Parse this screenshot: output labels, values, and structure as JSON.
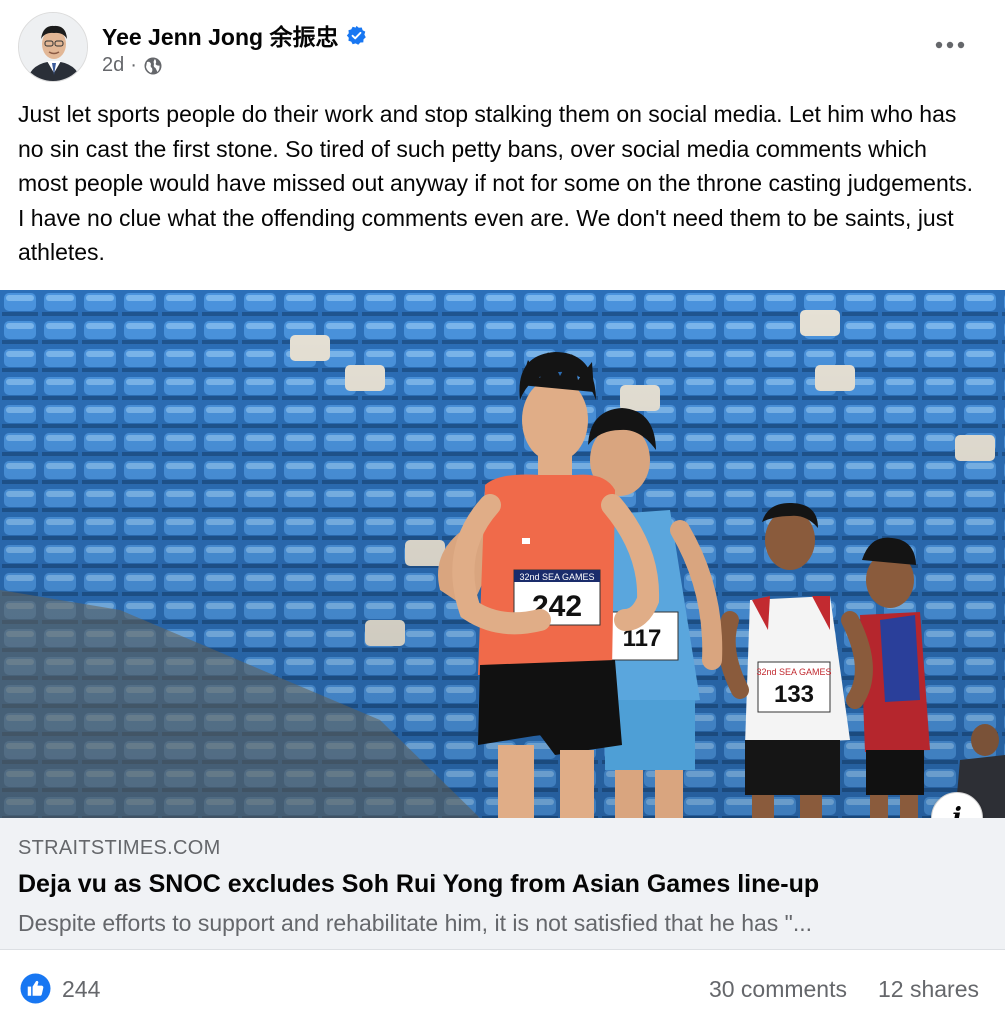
{
  "post": {
    "author": "Yee Jenn Jong 余振忠",
    "time": "2d",
    "separator": "·",
    "text": "Just let sports people do their work and stop stalking them on social media. Let him who has no sin cast the first stone. So tired of such petty bans, over social media comments which most people would have missed out anyway if not for some on the throne casting judgements. I have no clue what the offending comments  even are. We don't need them to be saints, just athletes."
  },
  "photo": {
    "bibs": [
      "242",
      "117",
      "133"
    ],
    "bib_caption": "32nd SEA GAMES"
  },
  "link": {
    "domain": "STRAITSTIMES.COM",
    "title": "Deja vu as SNOC excludes Soh Rui Yong from Asian Games line-up",
    "description": "Despite efforts to support and rehabilitate him, it is not satisfied that he has \"..."
  },
  "stats": {
    "likes": "244",
    "comments": "30 comments",
    "shares": "12 shares"
  },
  "colors": {
    "like_blue": "#1877f2",
    "secondary_text": "#65676b",
    "link_bg": "#f0f2f5",
    "verified_blue": "#1877f2"
  },
  "icons": [
    "verified-badge-icon",
    "globe-icon",
    "more-options-icon",
    "info-icon",
    "like-icon"
  ]
}
